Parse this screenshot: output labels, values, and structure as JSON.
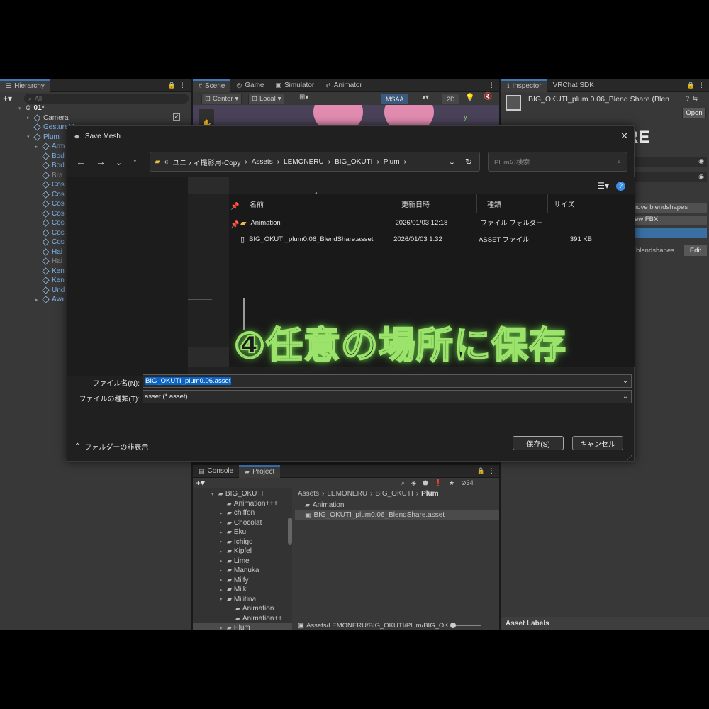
{
  "hierarchy": {
    "tab": "Hierarchy",
    "search_placeholder": "All",
    "scene": "01*",
    "items": [
      {
        "label": "Camera",
        "indent": 1,
        "style": "normal"
      },
      {
        "label": "GestureManager",
        "indent": 1,
        "style": "blue"
      },
      {
        "label": "Plum",
        "indent": 1,
        "style": "blue"
      },
      {
        "label": "Arm",
        "indent": 2,
        "style": "blue"
      },
      {
        "label": "Bod",
        "indent": 2,
        "style": "blue"
      },
      {
        "label": "Bod",
        "indent": 2,
        "style": "blue"
      },
      {
        "label": "Bra",
        "indent": 2,
        "style": "dim"
      },
      {
        "label": "Cos",
        "indent": 2,
        "style": "blue"
      },
      {
        "label": "Cos",
        "indent": 2,
        "style": "blue"
      },
      {
        "label": "Cos",
        "indent": 2,
        "style": "blue"
      },
      {
        "label": "Cos",
        "indent": 2,
        "style": "blue"
      },
      {
        "label": "Cos",
        "indent": 2,
        "style": "blue"
      },
      {
        "label": "Cos",
        "indent": 2,
        "style": "blue"
      },
      {
        "label": "Cos",
        "indent": 2,
        "style": "blue"
      },
      {
        "label": "Hai",
        "indent": 2,
        "style": "blue"
      },
      {
        "label": "Hai",
        "indent": 2,
        "style": "dim"
      },
      {
        "label": "Ken",
        "indent": 2,
        "style": "blue"
      },
      {
        "label": "Ken",
        "indent": 2,
        "style": "blue"
      },
      {
        "label": "Und",
        "indent": 2,
        "style": "blue"
      },
      {
        "label": "Ava",
        "indent": 2,
        "style": "blue"
      }
    ]
  },
  "scene_tabs": [
    "Scene",
    "Game",
    "Simulator",
    "Animator"
  ],
  "scene_toolbar": {
    "pivot": "Center",
    "space": "Local",
    "msaa": "MSAA",
    "mode2d": "2D",
    "axis_y": "y"
  },
  "inspector": {
    "tabs": [
      "Inspector",
      "VRChat SDK"
    ],
    "object_name": "BIG_OKUTI_plum 0.06_Blend Share (Blen",
    "open_label": "Open",
    "logo_partial": "RE",
    "rows": [
      "nove blendshapes",
      "ew FBX",
      "blendshapes"
    ],
    "edit_label": "Edit",
    "asset_labels": "Asset Labels"
  },
  "project": {
    "tabs": [
      "Console",
      "Project"
    ],
    "hidden_count": "34",
    "breadcrumb": [
      "Assets",
      "LEMONERU",
      "BIG_OKUTI",
      "Plum"
    ],
    "tree": [
      {
        "label": "BIG_OKUTI",
        "indent": 0,
        "open": true
      },
      {
        "label": "Animation+++",
        "indent": 1,
        "open": null
      },
      {
        "label": "chiffon",
        "indent": 1,
        "open": false
      },
      {
        "label": "Chocolat",
        "indent": 1,
        "open": false
      },
      {
        "label": "Eku",
        "indent": 1,
        "open": false
      },
      {
        "label": "Ichigo",
        "indent": 1,
        "open": false
      },
      {
        "label": "Kipfel",
        "indent": 1,
        "open": false
      },
      {
        "label": "Lime",
        "indent": 1,
        "open": false
      },
      {
        "label": "Manuka",
        "indent": 1,
        "open": false
      },
      {
        "label": "Milfy",
        "indent": 1,
        "open": false
      },
      {
        "label": "Milk",
        "indent": 1,
        "open": false
      },
      {
        "label": "Militina",
        "indent": 1,
        "open": true
      },
      {
        "label": "Animation",
        "indent": 2,
        "open": null
      },
      {
        "label": "Animation++",
        "indent": 2,
        "open": null
      },
      {
        "label": "Plum",
        "indent": 1,
        "open": true
      }
    ],
    "files": [
      "Animation",
      "BIG_OKUTI_plum0.06_BlendShare.asset"
    ],
    "status_path": "Assets/LEMONERU/BIG_OKUTI/Plum/BIG_OK"
  },
  "dialog": {
    "title": "Save Mesh",
    "address": [
      "ユニティ撮影用-Copy",
      "Assets",
      "LEMONERU",
      "BIG_OKUTI",
      "Plum"
    ],
    "search_placeholder": "Plumの検索",
    "columns": [
      "名前",
      "更新日時",
      "種類",
      "サイズ"
    ],
    "files": [
      {
        "name": "Animation",
        "date": "2026/01/03 12:18",
        "type": "ファイル フォルダー",
        "size": "",
        "folder": true
      },
      {
        "name": "BIG_OKUTI_plum0.06_BlendShare.asset",
        "date": "2026/01/03 1:32",
        "type": "ASSET ファイル",
        "size": "391 KB",
        "folder": false
      }
    ],
    "filename_label": "ファイル名(N):",
    "filename_value": "BIG_OKUTI_plum0.06.asset",
    "filetype_label": "ファイルの種類(T):",
    "filetype_value": "asset (*.asset)",
    "hide_folders_label": "フォルダーの非表示",
    "save_label": "保存(S)",
    "cancel_label": "キャンセル"
  },
  "annotation": "④任意の場所に保存",
  "colors": {
    "accent": "#3a79bb",
    "selection": "#0a64c8",
    "overlay_glow": "#9be36b"
  }
}
